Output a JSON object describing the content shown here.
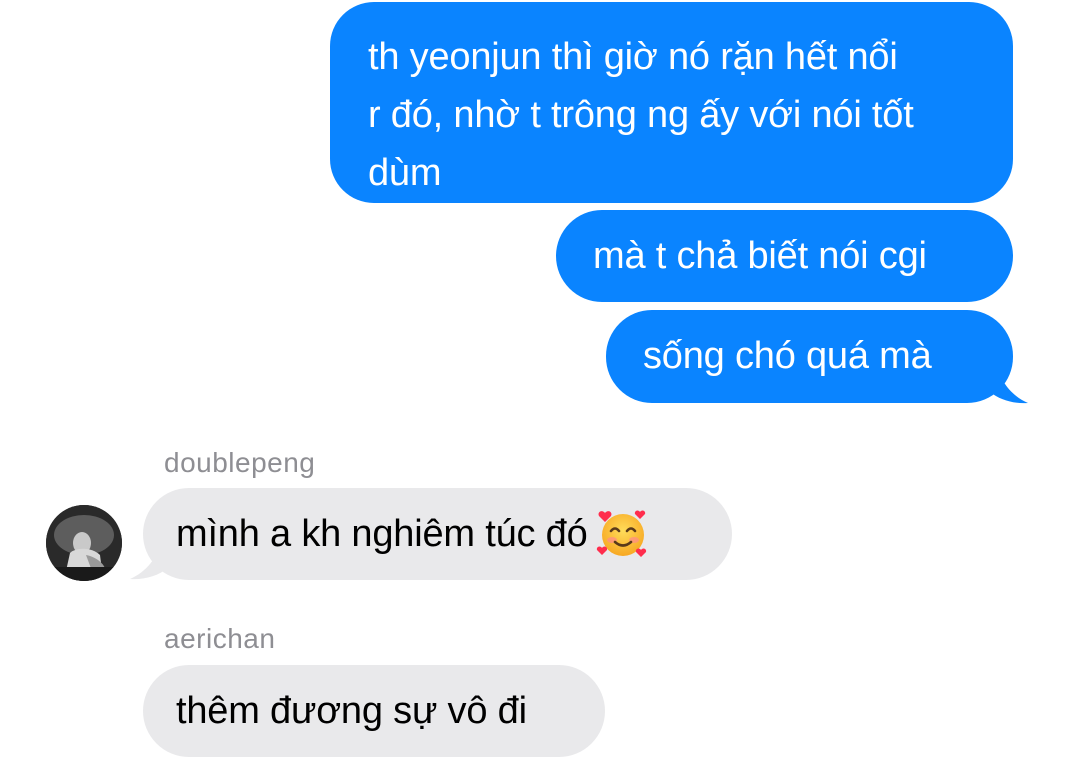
{
  "messages": [
    {
      "direction": "sent",
      "lines": [
        "th yeonjun thì giờ nó rặn hết nổi",
        "r đó, nhờ t trông ng ấy với nói tốt",
        "dùm"
      ]
    },
    {
      "direction": "sent",
      "text": "mà t chả biết nói cgi"
    },
    {
      "direction": "sent",
      "text": "sống chó quá mà"
    },
    {
      "direction": "received",
      "sender": "doublepeng",
      "text": "mình a kh nghiêm túc đó",
      "emoji": "smiling-face-with-hearts"
    },
    {
      "direction": "received",
      "sender": "aerichan",
      "text": "thêm đương sự vô đi"
    }
  ],
  "colors": {
    "sent_bubble": "#0a84ff",
    "received_bubble": "#e9e9eb",
    "sender_name": "#8e8e93"
  }
}
